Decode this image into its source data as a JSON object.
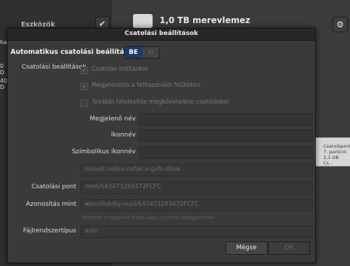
{
  "background": {
    "left_panel_title": "Eszközök",
    "disk_title": "1,0 TB merevlemez",
    "left_fragments": [
      "ha",
      "0",
      "D",
      "40",
      "D",
      "40",
      "D"
    ],
    "partition_lines": [
      "Csatolópont",
      "7. partíció",
      "2,1 GB Cs..."
    ]
  },
  "dialog": {
    "title": "Csatolási beállítások",
    "automatic_label": "Automatikus csatolási beállítások",
    "switch": {
      "on": "BE",
      "off": "KI"
    },
    "settings_label": "Csatolási beállítások",
    "checkboxes": [
      {
        "label": "Csatolás indításkor",
        "checked": true
      },
      {
        "label": "Megjelenítés a felhasználói felületen",
        "checked": true
      },
      {
        "label": "További hitelesítés megkövetelése csatoláskor",
        "checked": false
      }
    ],
    "display_name_label": "Megjelenő név",
    "icon_name_label": "Ikonnév",
    "symbolic_icon_label": "Szimbolikus ikonnév",
    "options_value": "nosuid,nodev,nofail,x-gvfs-show",
    "mount_point_label": "Csatolási pont",
    "mount_point_value": "/mnt/643473293472FCFC",
    "identify_as_label": "Azonosítás mint",
    "identify_as_value": "/dev/disk/by-uuid/643473293472FCFC",
    "hint": "Megfelel a meglévő fstab vagy crypttab bejegyzésnek",
    "fs_type_label": "Fájlrendszertípus",
    "fs_type_value": "auto",
    "cancel_label": "Mégse",
    "ok_label": "OK"
  },
  "icons": {
    "check": "check-icon",
    "gear": "gear-icon",
    "disk": "disk-icon",
    "chevron": "chevron-down-icon"
  }
}
